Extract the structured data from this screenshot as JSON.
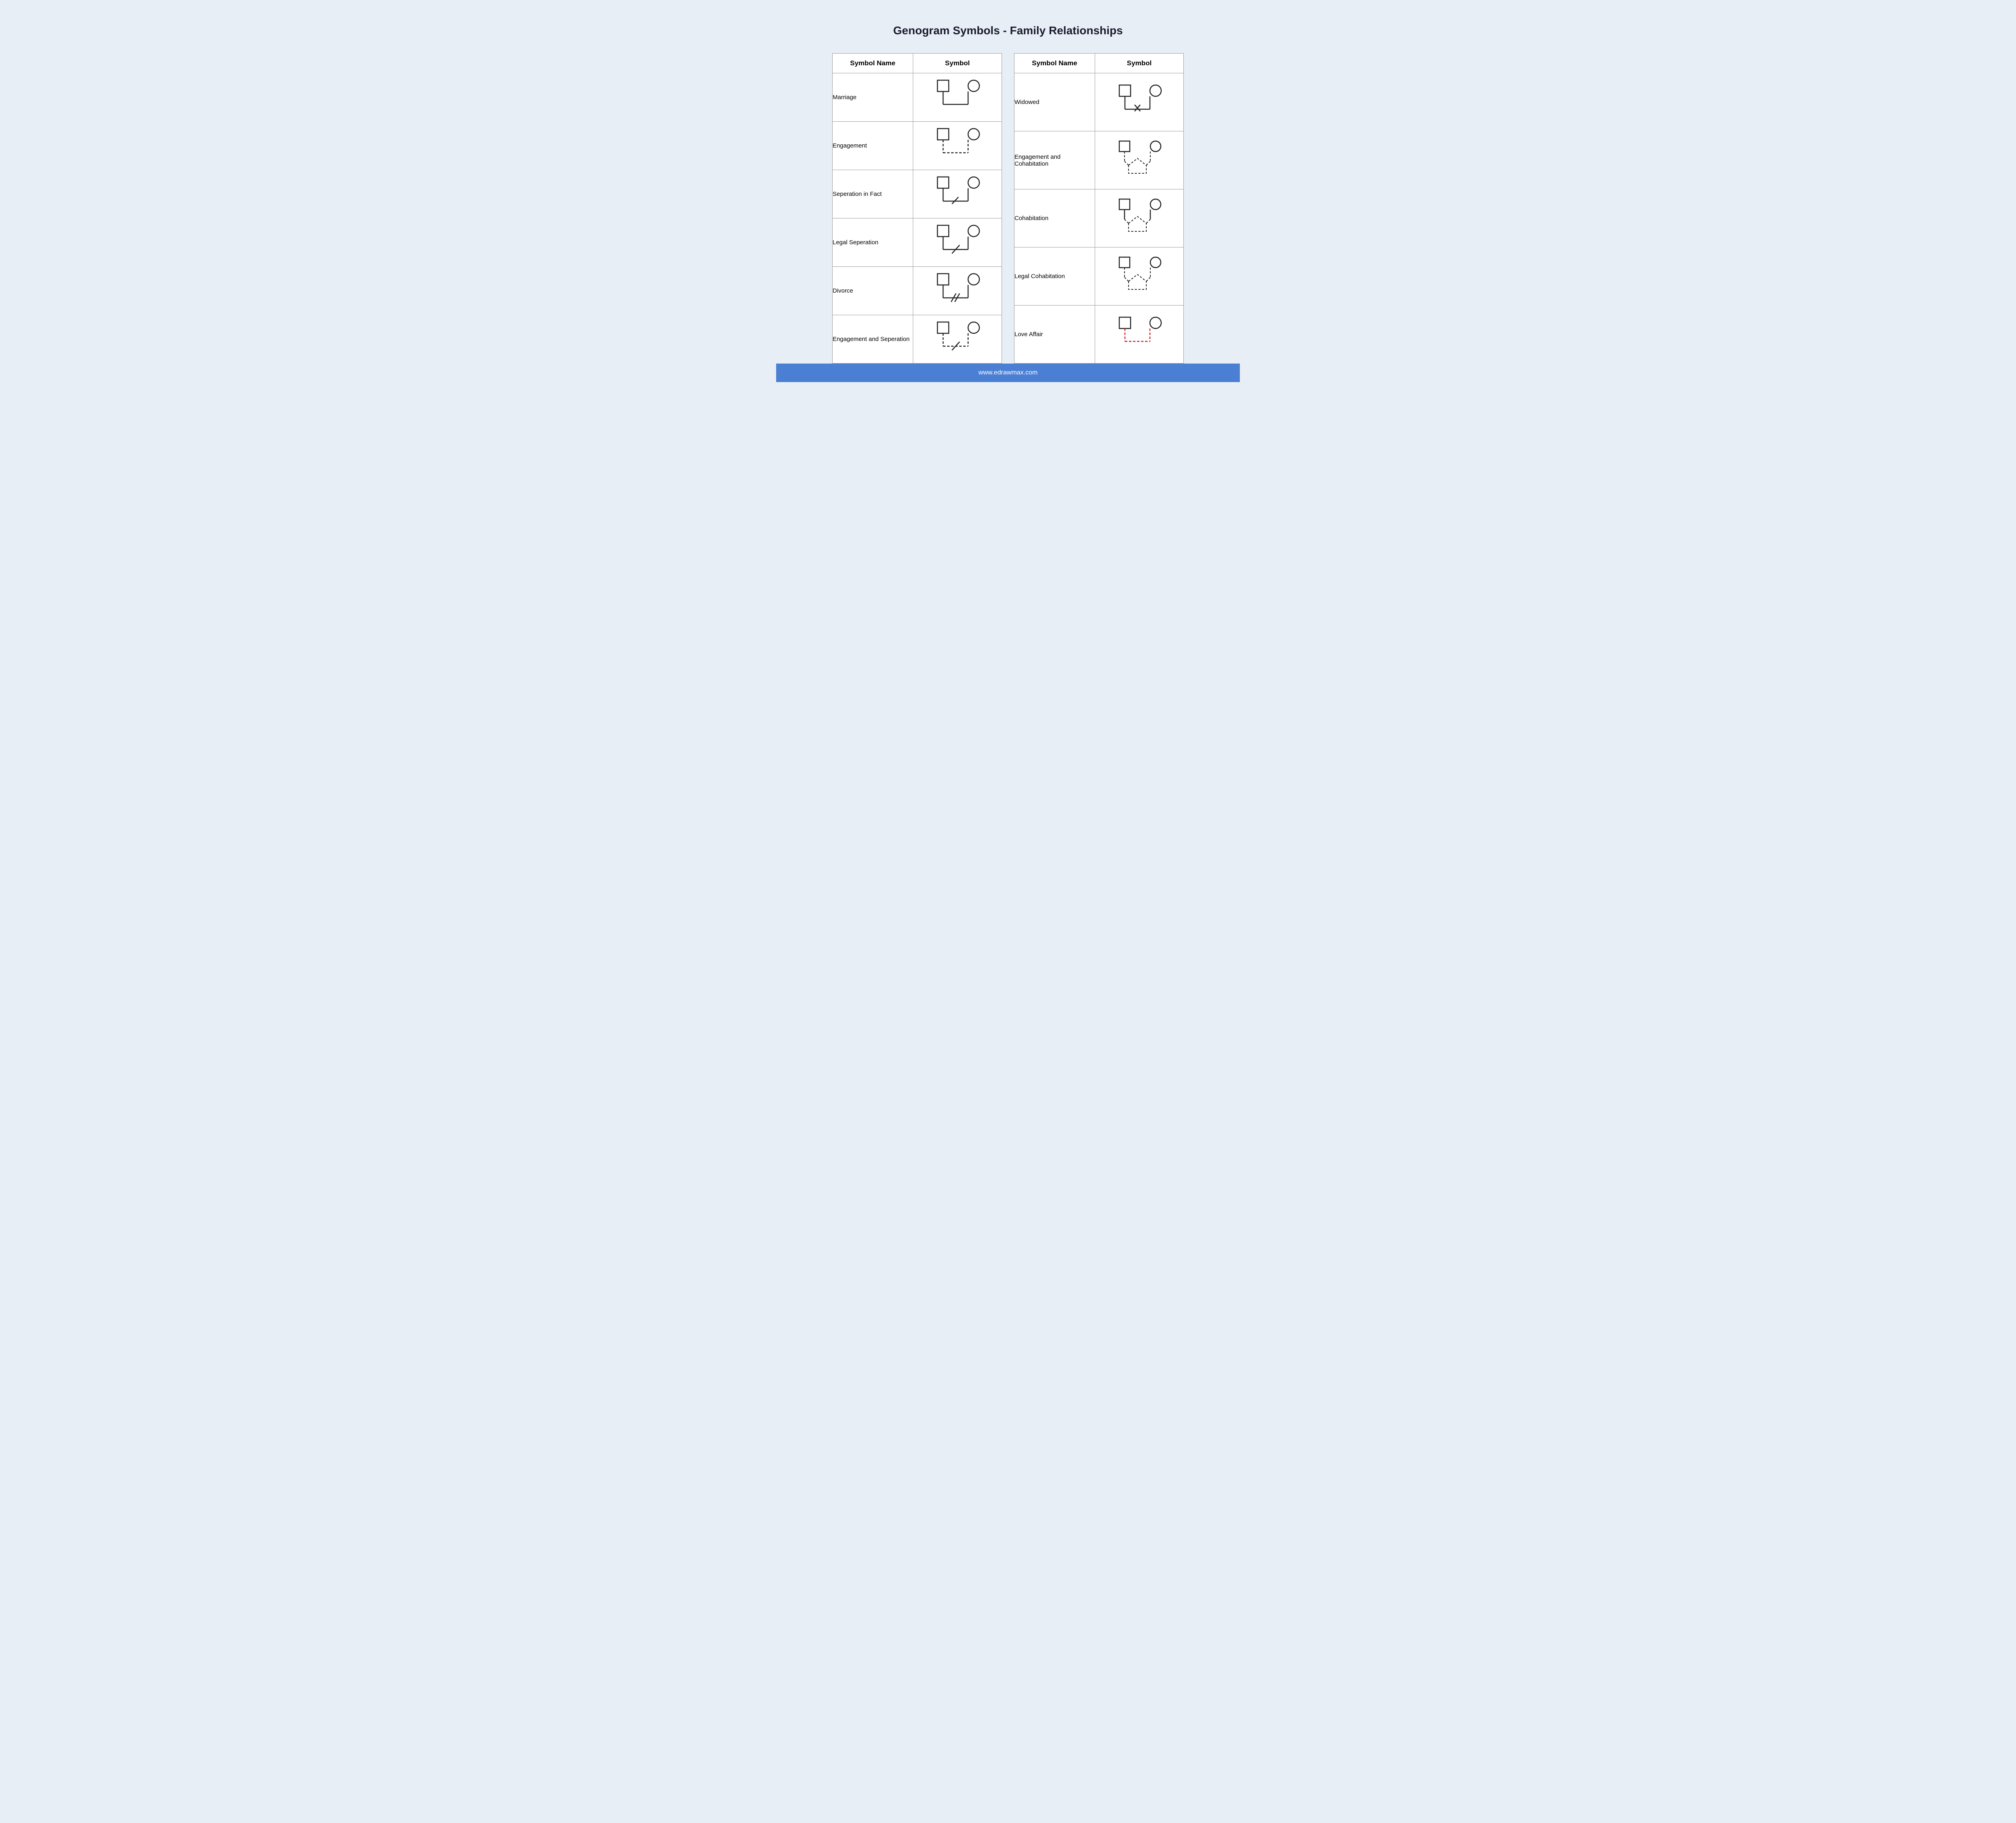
{
  "title": "Genogram Symbols - Family Relationships",
  "left_table": {
    "headers": [
      "Symbol Name",
      "Symbol"
    ],
    "rows": [
      {
        "name": "Marriage"
      },
      {
        "name": "Engagement"
      },
      {
        "name": "Seperation in Fact"
      },
      {
        "name": "Legal Seperation"
      },
      {
        "name": "Divorce"
      },
      {
        "name": "Engagement and Seperation"
      }
    ]
  },
  "right_table": {
    "headers": [
      "Symbol Name",
      "Symbol"
    ],
    "rows": [
      {
        "name": "Widowed"
      },
      {
        "name": "Engagement and\nCohabitation"
      },
      {
        "name": "Cohabitation"
      },
      {
        "name": "Legal Cohabitation"
      },
      {
        "name": "Love Affair"
      }
    ]
  },
  "footer": "www.edrawmax.com"
}
